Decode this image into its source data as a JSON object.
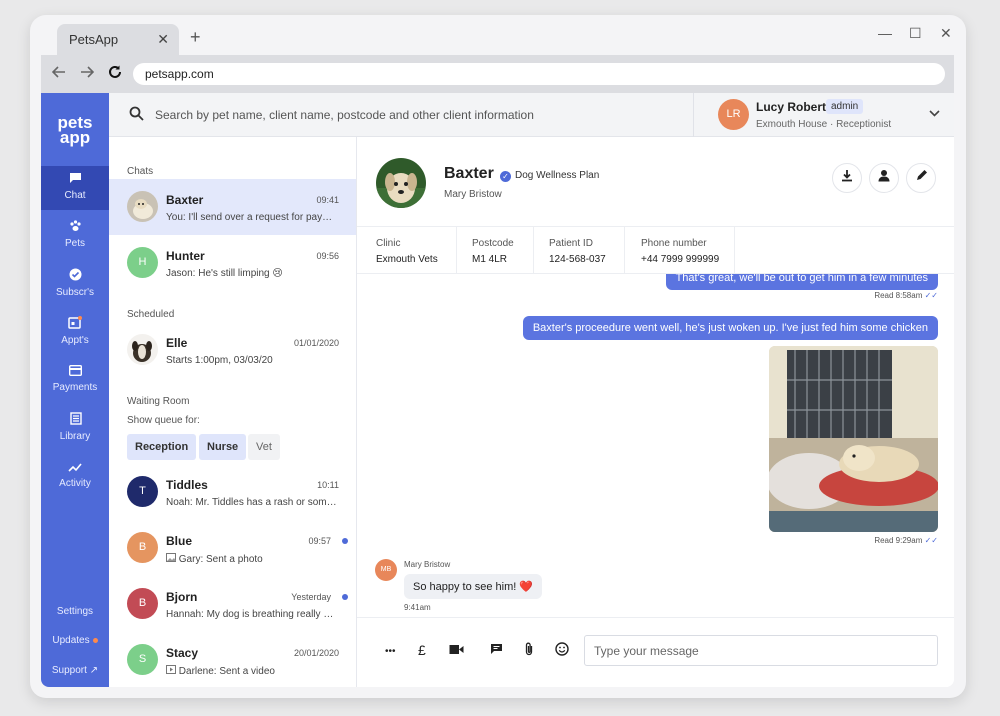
{
  "browser": {
    "tab_title": "PetsApp",
    "tab_close": "✕",
    "new_tab": "+",
    "url": "petsapp.com",
    "window_controls": [
      "—",
      "☐",
      "✕"
    ]
  },
  "sidebar": {
    "logo": [
      "pets",
      "app"
    ],
    "nav": [
      {
        "icon": "chat-icon",
        "glyph": "■",
        "label": "Chat"
      },
      {
        "icon": "paw-icon",
        "glyph": "✿",
        "label": "Pets"
      },
      {
        "icon": "badge-check-icon",
        "glyph": "✔",
        "label": "Subscr's"
      },
      {
        "icon": "calendar-icon",
        "glyph": "▣",
        "label": "Appt's"
      },
      {
        "icon": "card-icon",
        "glyph": "▭",
        "label": "Payments"
      },
      {
        "icon": "library-icon",
        "glyph": "▤",
        "label": "Library"
      },
      {
        "icon": "trend-icon",
        "glyph": "↗",
        "label": "Activity"
      }
    ],
    "bottom": {
      "settings": "Settings",
      "updates": "Updates",
      "support": "Support",
      "support_icon": "↗"
    }
  },
  "search": {
    "placeholder": "Search by pet name, client name, postcode and other client information"
  },
  "user": {
    "initials": "LR",
    "name": "Lucy Roberts",
    "role_badge": "admin",
    "location": "Exmouth House",
    "title": "Receptionist",
    "separator": "·"
  },
  "chatlist": {
    "chats_label": "Chats",
    "chats": [
      {
        "name": "Baxter",
        "time": "09:41",
        "preview": "You: I'll send over a request for payment now",
        "selected": true
      },
      {
        "name": "Hunter",
        "initial": "H",
        "color": "#7ccf8a",
        "time": "09:56",
        "preview": "Jason: He's still limping 😢"
      }
    ],
    "scheduled_label": "Scheduled",
    "scheduled": [
      {
        "name": "Elle",
        "time": "01/01/2020",
        "preview": "Starts 1:00pm, 03/03/20"
      }
    ],
    "waiting_label": "Waiting Room",
    "queue_label": "Show queue for:",
    "queue_buttons": [
      "Reception",
      "Nurse",
      "Vet"
    ],
    "waiting": [
      {
        "name": "Tiddles",
        "initial": "T",
        "color": "#1f2a6b",
        "time": "10:11",
        "preview": "Noah: Mr. Tiddles has a rash or something"
      },
      {
        "name": "Blue",
        "initial": "B",
        "color": "#e59560",
        "time": "09:57",
        "preview": "Gary: Sent a photo",
        "unread": true
      },
      {
        "name": "Bjorn",
        "initial": "B",
        "color": "#c24b55",
        "time": "Yesterday",
        "preview": "Hannah: My dog is breathing really heavily",
        "unread": true
      },
      {
        "name": "Stacy",
        "initial": "S",
        "color": "#7ccf8a",
        "time": "20/01/2020",
        "preview": "Darlene: Sent a video"
      }
    ]
  },
  "patient": {
    "name": "Baxter",
    "plan": "Dog Wellness Plan",
    "owner": "Mary Bristow",
    "info": [
      {
        "label": "Clinic",
        "value": "Exmouth Vets"
      },
      {
        "label": "Postcode",
        "value": "M1 4LR"
      },
      {
        "label": "Patient ID",
        "value": "124-568-037"
      },
      {
        "label": "Phone number",
        "value": "+44 7999 999999"
      }
    ]
  },
  "messages": {
    "out1": "That's great, we'll be out to get him in a few minutes",
    "read1": "Read 8:58am",
    "out2": "Baxter's proceedure went well, he's just woken up. I've just fed him some chicken",
    "read2": "Read 9:29am",
    "in_initials": "MB",
    "in_name": "Mary Bristow",
    "in_text": "So happy to see him! ❤️",
    "in_time": "9:41am"
  },
  "composer": {
    "placeholder": "Type your message",
    "more": "•••",
    "pound": "£"
  },
  "colors": {
    "brand": "#4e6ad8",
    "bubble_out": "#5b74e0"
  }
}
